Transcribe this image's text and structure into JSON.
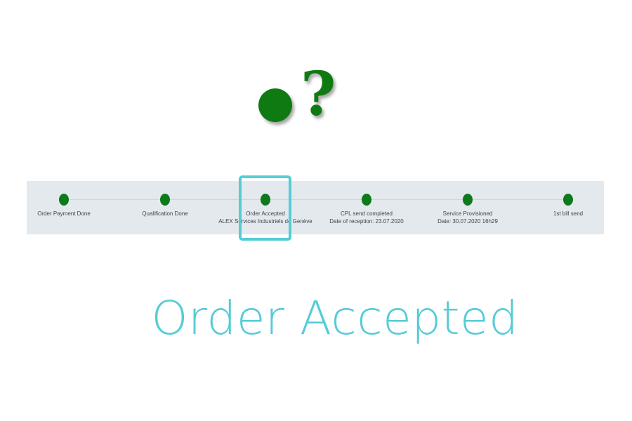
{
  "hero": {
    "icon": "green-dot-question-icon",
    "glyph": "?",
    "color": "#0f7a12"
  },
  "timeline": {
    "steps": [
      {
        "label": "Order Payment Done",
        "sub": ""
      },
      {
        "label": "Qualification Done",
        "sub": ""
      },
      {
        "label": "Order Accepted",
        "sub": "ALEX Services Industriels de Genève"
      },
      {
        "label": "CPL send completed",
        "sub": "Date of reception: 23.07.2020"
      },
      {
        "label": "Service Provisioned",
        "sub": "Date: 30.07.2020 16h29"
      },
      {
        "label": "1st bill send",
        "sub": ""
      }
    ],
    "dot_color": "#0d7a1b",
    "highlight_color": "#55ccd6"
  },
  "caption": {
    "text": "Order Accepted",
    "color": "#55ccd6"
  }
}
